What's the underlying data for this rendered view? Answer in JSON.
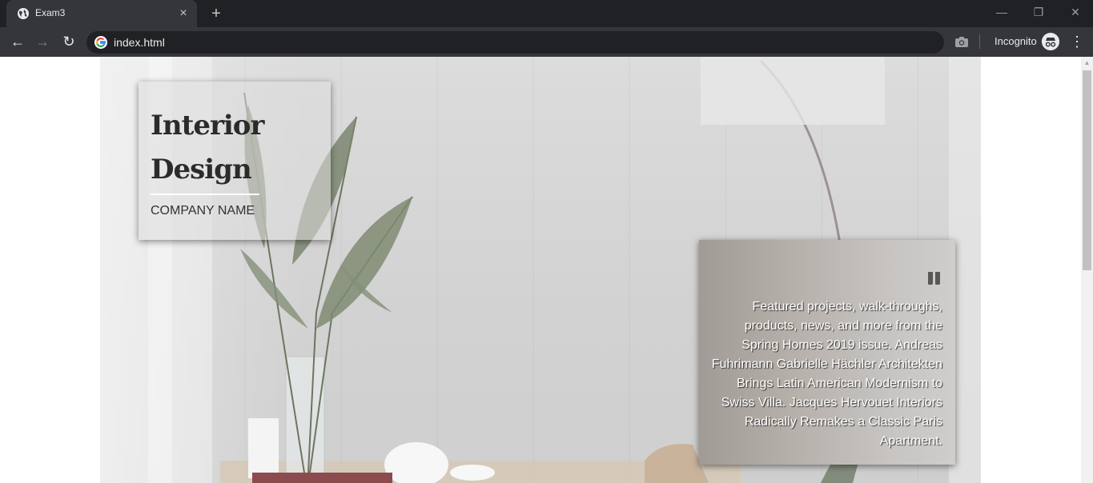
{
  "browser": {
    "tab_title": "Exam3",
    "tab_close": "×",
    "new_tab": "+",
    "url": "index.html",
    "incognito_label": "Incognito",
    "window_controls": {
      "minimize": "—",
      "maximize": "❐",
      "close": "✕"
    },
    "nav": {
      "back": "←",
      "forward": "→",
      "reload": "↻",
      "menu": "⋮"
    },
    "icons": {
      "favicon": "globe-icon",
      "omnibox": "google-icon",
      "camera": "camera-icon",
      "incognito": "incognito-icon"
    }
  },
  "hero": {
    "title_line1": "Interior",
    "title_line2": "Design",
    "company_name": "COMPANY NAME",
    "quote_icon": "quote-icon",
    "quote_text": "Featured projects, walk-throughs, products, news, and more from the Spring Homes 2019 issue. Andreas Fuhrimann Gabrielle Hächler Architekten Brings Latin American Modernism to Swiss Villa. Jacques Hervouet Interiors Radically Remakes a Classic Paris Apartment."
  },
  "colors": {
    "chrome_dark": "#202124",
    "chrome_tab": "#35363a",
    "title_text": "#2b2b2b",
    "quote_bg": "#b5afa9"
  }
}
